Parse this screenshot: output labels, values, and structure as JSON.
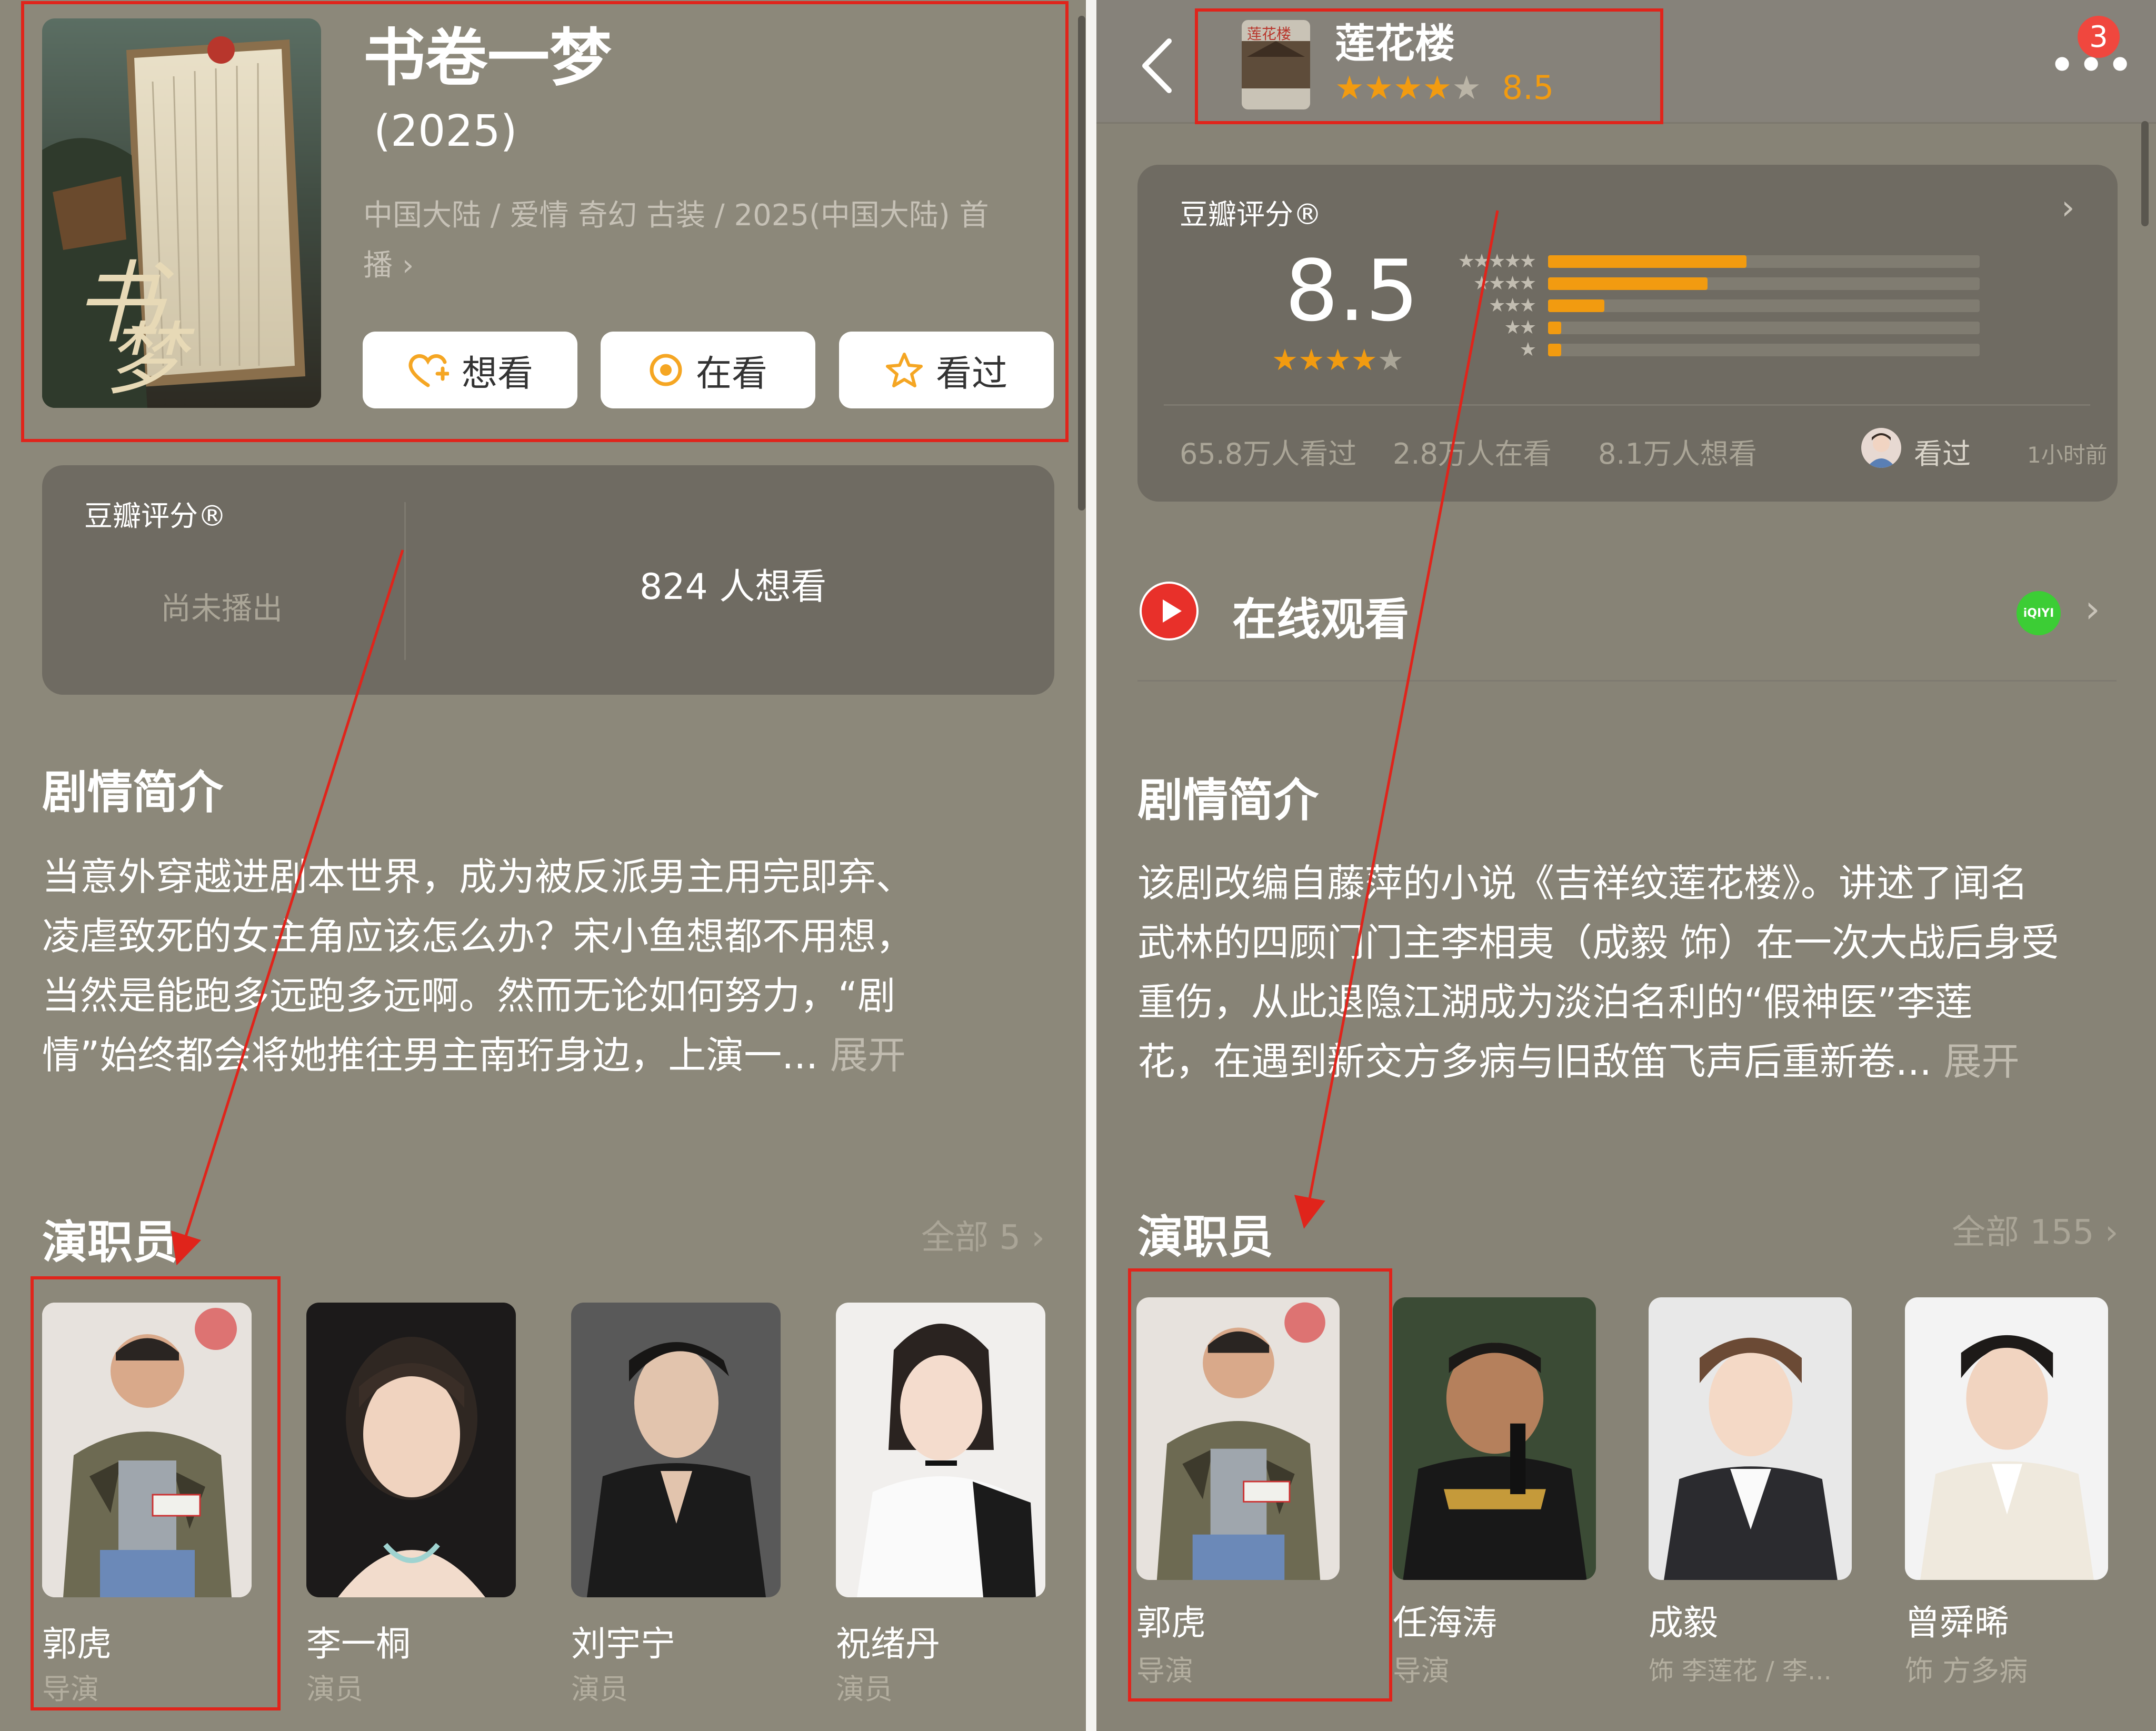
{
  "colors": {
    "accent_orange": "#f29b10",
    "annotation_red": "#e0241b",
    "play_red": "#e8302a",
    "iqiyi_green": "#3ccd35"
  },
  "left": {
    "title": "书卷一梦",
    "year": "(2025)",
    "meta_line1": "中国大陆 / 爱情 奇幻 古装 / 2025(中国大陆) 首",
    "meta_line2": "播",
    "buttons": {
      "want": "想看",
      "watching": "在看",
      "watched": "看过"
    },
    "rating_card": {
      "brand": "豆瓣评分®",
      "status": "尚未播出",
      "wish_count": "824 人想看"
    },
    "synopsis": {
      "title": "剧情简介",
      "lines": [
        "当意外穿越进剧本世界，成为被反派男主用完即弃、",
        "凌虐致死的女主角应该怎么办？宋小鱼想都不用想，",
        "当然是能跑多远跑多远啊。然而无论如何努力，“剧",
        "情”始终都会将她推往男主南珩身边，上演一..."
      ],
      "expand": "展开"
    },
    "cast": {
      "title": "演职员",
      "all_label": "全部 5",
      "members": [
        {
          "name": "郭虎",
          "role": "导演"
        },
        {
          "name": "李一桐",
          "role": "演员"
        },
        {
          "name": "刘宇宁",
          "role": "演员"
        },
        {
          "name": "祝绪丹",
          "role": "演员"
        }
      ]
    }
  },
  "right": {
    "notification_count": "3",
    "header": {
      "title": "莲花楼",
      "stars": "★★★★",
      "half_star": "★",
      "rating": "8.5"
    },
    "rating_card": {
      "brand": "豆瓣评分®",
      "score": "8.5",
      "stars": "★★★★",
      "half_star": "★",
      "distribution": [
        {
          "stars": "★★★★★",
          "fraction": 0.46
        },
        {
          "stars": "★★★★",
          "fraction": 0.37
        },
        {
          "stars": "★★★",
          "fraction": 0.13
        },
        {
          "stars": "★★",
          "fraction": 0.03
        },
        {
          "stars": "★",
          "fraction": 0.03
        }
      ],
      "watched_count": "65.8万人看过",
      "watching_count": "2.8万人在看",
      "wish_count": "8.1万人想看",
      "my_status": "看过",
      "my_time": "1小时前"
    },
    "online": {
      "label": "在线观看",
      "provider_icon_text": "iQIYI"
    },
    "synopsis": {
      "title": "剧情简介",
      "lines": [
        "该剧改编自藤萍的小说《吉祥纹莲花楼》。讲述了闻名",
        "武林的四顾门门主李相夷（成毅 饰）在一次大战后身受",
        "重伤，从此退隐江湖成为淡泊名利的“假神医”李莲",
        "花，在遇到新交方多病与旧敌笛飞声后重新卷..."
      ],
      "expand": "展开"
    },
    "cast": {
      "title": "演职员",
      "all_label": "全部 155",
      "members": [
        {
          "name": "郭虎",
          "role": "导演"
        },
        {
          "name": "任海涛",
          "role": "导演"
        },
        {
          "name": "成毅",
          "role": "饰 李莲花 / 李..."
        },
        {
          "name": "曾舜晞",
          "role": "饰 方多病"
        }
      ]
    }
  }
}
